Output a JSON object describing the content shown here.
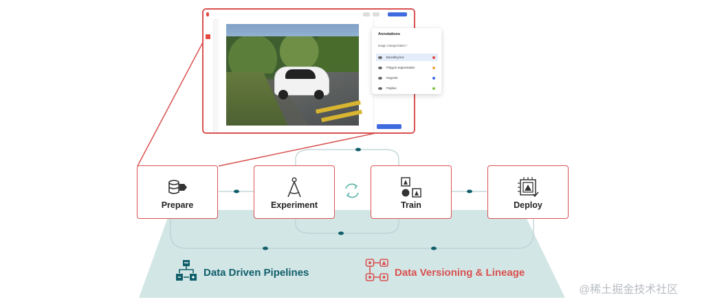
{
  "stages": [
    {
      "label": "Prepare",
      "icon": "database-tag-icon"
    },
    {
      "label": "Experiment",
      "icon": "compass-icon"
    },
    {
      "label": "Train",
      "icon": "shapes-icon"
    },
    {
      "label": "Deploy",
      "icon": "image-chip-icon"
    }
  ],
  "cycle_icon": "refresh-cycle-icon",
  "features": [
    {
      "label": "Data Driven Pipelines",
      "icon": "pipeline-flow-icon",
      "color": "#0f5e6a"
    },
    {
      "label": "Data Versioning & Lineage",
      "icon": "lineage-graph-icon",
      "color": "#d9504f"
    }
  ],
  "annotation_panel": {
    "title": "Annotations",
    "subtitle": "Image Categorization *",
    "items": [
      {
        "label": "Bounding box",
        "color": "#e2483d",
        "selected": true
      },
      {
        "label": "Polygon segmentation",
        "color": "#f3a63a",
        "selected": false
      },
      {
        "label": "Keypoint",
        "color": "#3f6ae0",
        "selected": false
      },
      {
        "label": "Polyline",
        "color": "#7cc243",
        "selected": false
      }
    ]
  },
  "watermark": "@稀土掘金技术社区",
  "colors": {
    "accent_red": "#d9504f",
    "teal": "#0f5e6a",
    "panel_bg": "#d3e6e6",
    "button_blue": "#3f6ae0"
  }
}
